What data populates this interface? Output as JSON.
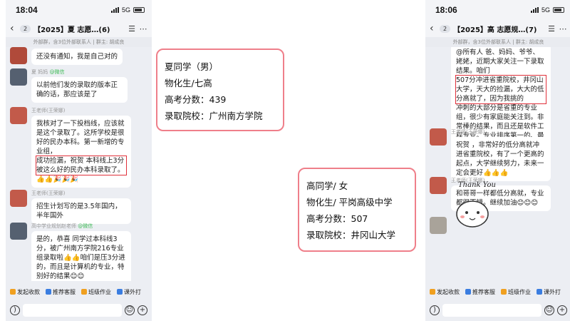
{
  "left_phone": {
    "time": "18:04",
    "network": "5G",
    "back_count": "2",
    "title": "【2025】夏   志愿…(6)",
    "subtitle": "外部群，含3位外部联系人 | 群主: 胡成良",
    "messages": [
      {
        "text": "还没有通知，我是自己对的"
      },
      {
        "sender": "夏   妈妈",
        "wx": "@微信",
        "text": "以前他们发的录取的版本正确的话，那应该是了"
      },
      {
        "sender": "王老师(王荣娜)",
        "text_lines": [
          "我核对了一下投档线，应该就是这个录取了。这所学校是很好的民办本科。第一新增的专业组，"
        ],
        "highlight": "成功捡漏，祝贺   本科线上3分被这么好的民办本科录取了。",
        "tail": "👍👍🎉🎉🎉"
      },
      {
        "sender": "王老师(王荣娜)",
        "text": "招生计划写的是3.5年国内，半年国外"
      },
      {
        "sender": "高中学业规划赵老师",
        "wx": "@微信",
        "text": "是的，恭喜   同学过本科线3分，被广州南方学院216专业组录取啦👍👍咱们是压3分进的，而且是计算机的专业，特别好的结果😊😊"
      }
    ],
    "toolbar": [
      "发起收款",
      "推荐客服",
      "班级作业",
      "课外打"
    ]
  },
  "card_left": {
    "name": "夏同学（男）",
    "subjects": "物化生/七高",
    "score": "高考分数：439",
    "school": "录取院校：广州南方学院"
  },
  "card_right": {
    "name": "高同学/ 女",
    "subjects": "物化生/ 平岗高级中学",
    "score": "高考分数：507",
    "school": "录取院校：井冈山大学"
  },
  "right_phone": {
    "time": "18:06",
    "network": "5G",
    "back_count": "2",
    "title": "【2025】高   志愿规…(7)",
    "subtitle": "外部群，含3位外部联系人 | 群主: 胡成良",
    "messages": [
      {
        "pre": "@所有人   爸、妈妈、爷爷、姥姥，近期大家关注一下录取结果。咱们",
        "highlight": "  507分冲进省重院校，井冈山大学，天大的捡漏，大大的低分高就了，因为我挑的",
        "tail": "冲刺的大部分是省重的专业组，很少有家庭能关注到。非常棒的结果，而且还是软件工程专业。专业排序第一的、最喜欢的专业。👍👍👍🎉🎉🎉"
      },
      {
        "sender": "王老师(王荣娜)",
        "text": "祝贺   ，非常好的低分高就冲进省重院校，有了一个更高的起点，大学继续努力，未来一定会更好👍👍👍"
      },
      {
        "sender": "王老师(王荣娜)",
        "text": "和哥哥一样都低分高就，专业都很不错。继续加油😊😊😊"
      }
    ],
    "sticker_text": "Thank You",
    "toolbar": [
      "发起收款",
      "推荐客服",
      "班级作业",
      "课外打"
    ]
  }
}
